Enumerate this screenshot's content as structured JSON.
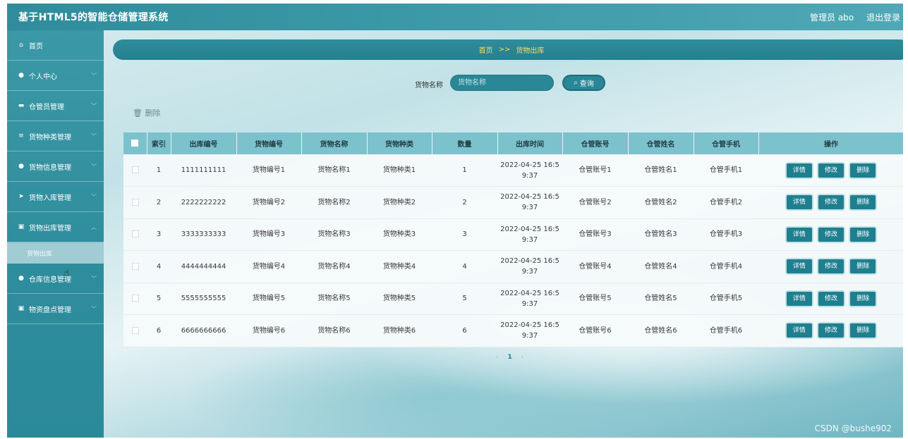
{
  "header": {
    "title": "基于HTML5的智能仓储管理系统",
    "user": "管理员 abo",
    "logout": "退出登录"
  },
  "sidebar": {
    "items": [
      {
        "label": "首页",
        "icon": "home-icon"
      },
      {
        "label": "个人中心",
        "icon": "user-icon"
      },
      {
        "label": "仓管员管理",
        "icon": "folder-icon"
      },
      {
        "label": "货物种类管理",
        "icon": "list-icon"
      },
      {
        "label": "货物信息管理",
        "icon": "user-icon"
      },
      {
        "label": "货物入库管理",
        "icon": "send-icon"
      },
      {
        "label": "货物出库管理",
        "icon": "doc-icon"
      },
      {
        "label": "仓库信息管理",
        "icon": "user-icon"
      },
      {
        "label": "物资盘点管理",
        "icon": "doc-icon"
      }
    ],
    "sub_active": "货物出库"
  },
  "breadcrumb": {
    "home": "首页",
    "separator": ">>",
    "current": "货物出库"
  },
  "search": {
    "label": "货物名称",
    "placeholder": "货物名称",
    "button": "查询"
  },
  "toolbar": {
    "delete": "删除"
  },
  "table": {
    "headers": [
      "索引",
      "出库编号",
      "货物编号",
      "货物名称",
      "货物种类",
      "数量",
      "出库时间",
      "仓管账号",
      "仓管姓名",
      "仓管手机",
      "操作"
    ],
    "rows": [
      [
        "1",
        "1111111111",
        "货物编号1",
        "货物名称1",
        "货物种类1",
        "1",
        "2022-04-25 16:5",
        "9:37",
        "仓管账号1",
        "仓管姓名1",
        "仓管手机1"
      ],
      [
        "2",
        "2222222222",
        "货物编号2",
        "货物名称2",
        "货物种类2",
        "2",
        "2022-04-25 16:5",
        "9:37",
        "仓管账号2",
        "仓管姓名2",
        "仓管手机2"
      ],
      [
        "3",
        "3333333333",
        "货物编号3",
        "货物名称3",
        "货物种类3",
        "3",
        "2022-04-25 16:5",
        "9:37",
        "仓管账号3",
        "仓管姓名3",
        "仓管手机3"
      ],
      [
        "4",
        "4444444444",
        "货物编号4",
        "货物名称4",
        "货物种类4",
        "4",
        "2022-04-25 16:5",
        "9:37",
        "仓管账号4",
        "仓管姓名4",
        "仓管手机4"
      ],
      [
        "5",
        "5555555555",
        "货物编号5",
        "货物名称5",
        "货物种类5",
        "5",
        "2022-04-25 16:5",
        "9:37",
        "仓管账号5",
        "仓管姓名5",
        "仓管手机5"
      ],
      [
        "6",
        "6666666666",
        "货物编号6",
        "货物名称6",
        "货物种类6",
        "6",
        "2022-04-25 16:5",
        "9:37",
        "仓管账号6",
        "仓管姓名6",
        "仓管手机6"
      ]
    ],
    "actions": [
      "详情",
      "修改",
      "删除"
    ]
  },
  "pager": {
    "prev": "‹",
    "page": "1",
    "next": "›"
  },
  "watermark": "CSDN @bushe902",
  "colors": {
    "primary": "#2a8796",
    "header": "#7cc2cd",
    "breadcrumb_text": "#ffd860"
  }
}
